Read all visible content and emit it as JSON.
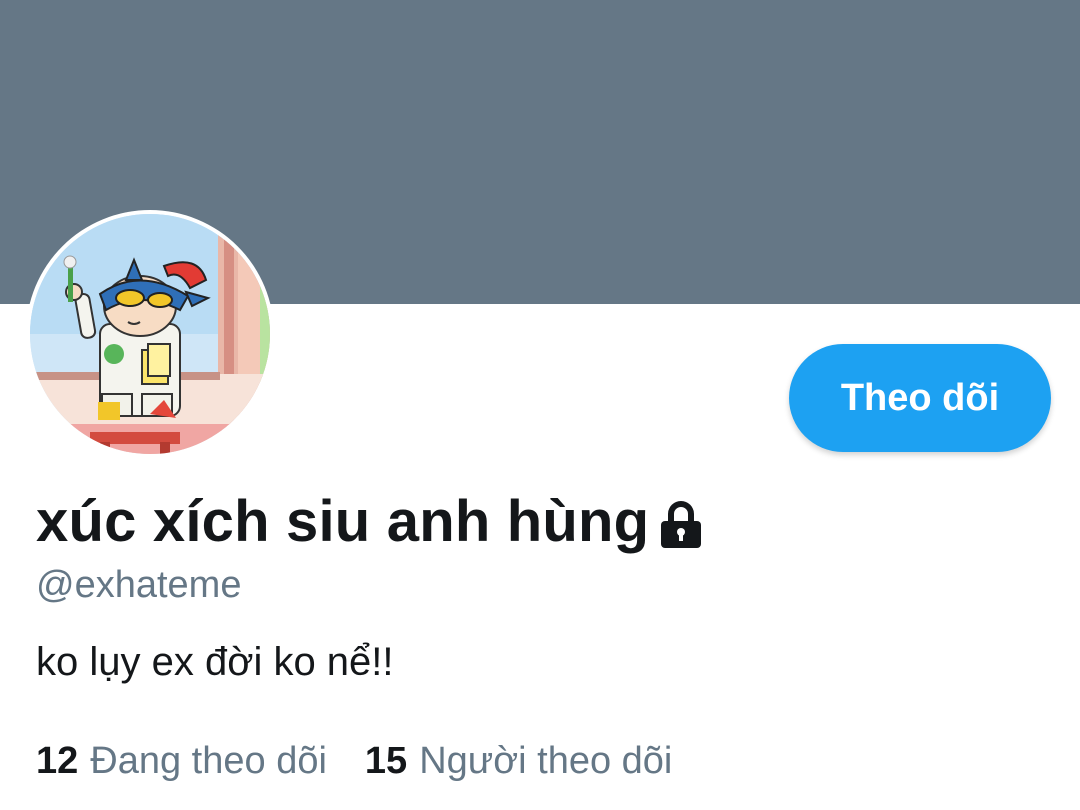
{
  "profile": {
    "display_name": "xúc xích siu anh hùng",
    "handle": "@exhateme",
    "bio": "ko lụy ex đời ko nể!!",
    "locked_icon": "lock-icon"
  },
  "actions": {
    "follow_label": "Theo dõi"
  },
  "stats": {
    "following_count": "12",
    "following_label": "Đang theo dõi",
    "followers_count": "15",
    "followers_label": "Người theo dõi"
  },
  "colors": {
    "banner": "#657786",
    "accent": "#1da1f2",
    "text_primary": "#14171a",
    "text_secondary": "#657786"
  }
}
